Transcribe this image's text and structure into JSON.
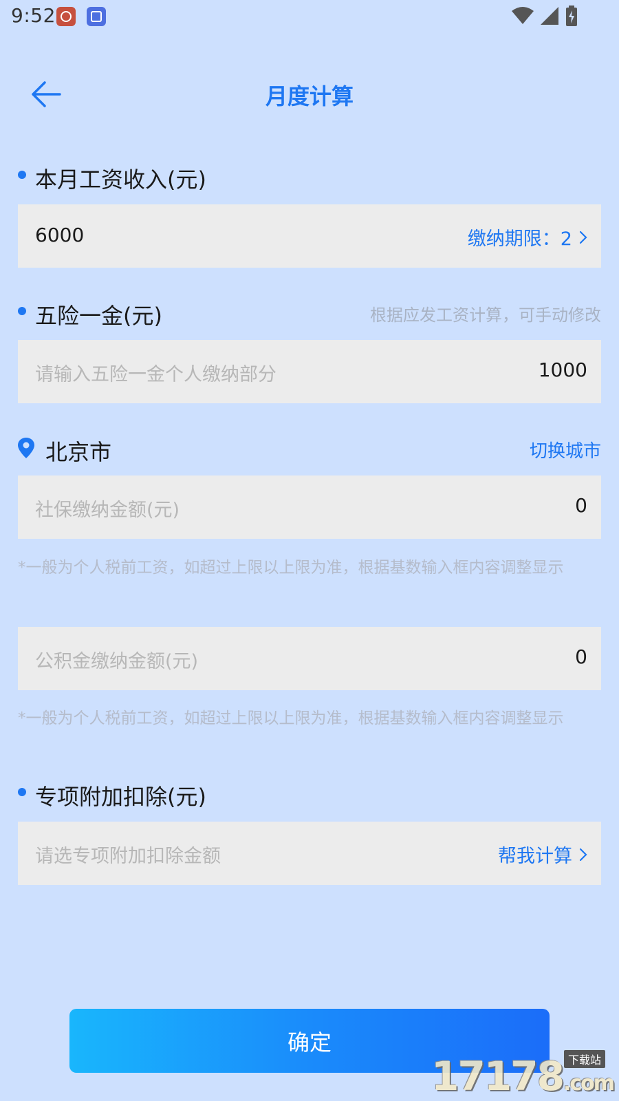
{
  "status_bar": {
    "time": "9:52",
    "icons": [
      "wifi-icon",
      "signal-icon",
      "battery-charging-icon"
    ]
  },
  "header": {
    "title": "月度计算",
    "back_icon": "arrow-left-icon"
  },
  "salary": {
    "label": "本月工资收入(元)",
    "value": "6000",
    "period_label": "缴纳期限：2"
  },
  "insurance": {
    "label": "五险一金(元)",
    "hint": "根据应发工资计算，可手动修改",
    "placeholder": "请输入五险一金个人缴纳部分",
    "value": "1000"
  },
  "city": {
    "name": "北京市",
    "switch_label": "切换城市",
    "icon": "location-pin-icon"
  },
  "social_security": {
    "placeholder": "社保缴纳金额(元)",
    "value": "0",
    "note": "*一般为个人税前工资，如超过上限以上限为准，根据基数输入框内容调整显示"
  },
  "housing_fund": {
    "placeholder": "公积金缴纳金额(元)",
    "value": "0",
    "note": "*一般为个人税前工资，如超过上限以上限为准，根据基数输入框内容调整显示"
  },
  "special_deduction": {
    "label": "专项附加扣除(元)",
    "placeholder": "请选专项附加扣除金额",
    "action_label": "帮我计算"
  },
  "confirm": {
    "label": "确定"
  },
  "watermark": {
    "text": "17178",
    "suffix": ".com",
    "tag": "下载站"
  },
  "colors": {
    "background": "#cde0fe",
    "accent": "#1e77f2",
    "field_bg": "#ececec",
    "button_start": "#19b6fc",
    "button_end": "#1b6df9"
  }
}
